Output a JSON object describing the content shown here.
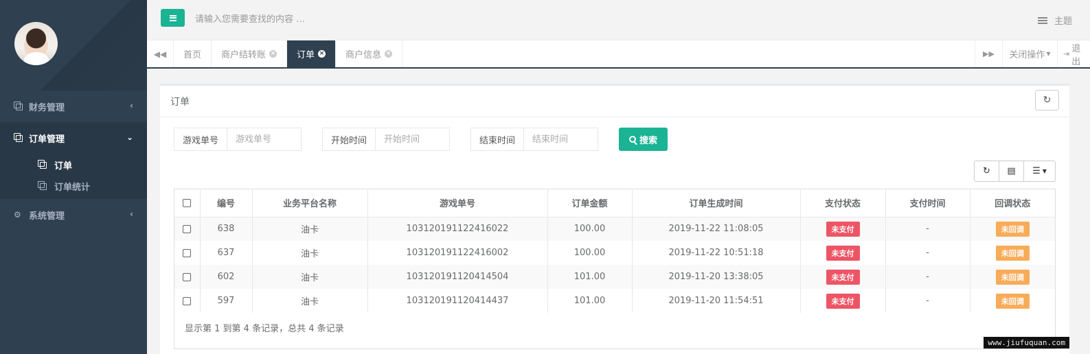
{
  "sidebar": {
    "menus": [
      {
        "label": "财务管理",
        "arrow": "‹"
      },
      {
        "label": "订单管理",
        "arrow": "⌄"
      },
      {
        "label": "系统管理",
        "arrow": "‹"
      }
    ],
    "submenu": [
      {
        "label": "订单"
      },
      {
        "label": "订单统计"
      }
    ]
  },
  "header": {
    "search_placeholder": "请输入您需要查找的内容 …",
    "theme_label": "主题"
  },
  "tabs": {
    "items": [
      {
        "label": "首页"
      },
      {
        "label": "商户结转账"
      },
      {
        "label": "订单"
      },
      {
        "label": "商户信息"
      }
    ],
    "close_ops_label": "关闭操作",
    "logout_label": "退出"
  },
  "panel": {
    "title": "订单",
    "filters": {
      "game_order_label": "游戏单号",
      "game_order_placeholder": "游戏单号",
      "start_time_label": "开始时间",
      "start_time_placeholder": "开始时间",
      "end_time_label": "结束时间",
      "end_time_placeholder": "结束时间",
      "search_label": "搜索"
    },
    "table": {
      "headers": [
        "编号",
        "业务平台名称",
        "游戏单号",
        "订单金额",
        "订单生成时间",
        "支付状态",
        "支付时间",
        "回调状态"
      ],
      "rows": [
        {
          "id": "638",
          "platform": "油卡",
          "game_order": "103120191122416022",
          "amount": "100.00",
          "created": "2019-11-22 11:08:05",
          "pay_status": "未支付",
          "pay_time": "-",
          "callback": "未回调"
        },
        {
          "id": "637",
          "platform": "油卡",
          "game_order": "103120191122416002",
          "amount": "100.00",
          "created": "2019-11-22 10:51:18",
          "pay_status": "未支付",
          "pay_time": "-",
          "callback": "未回调"
        },
        {
          "id": "602",
          "platform": "油卡",
          "game_order": "103120191120414504",
          "amount": "101.00",
          "created": "2019-11-20 13:38:05",
          "pay_status": "未支付",
          "pay_time": "-",
          "callback": "未回调"
        },
        {
          "id": "597",
          "platform": "油卡",
          "game_order": "103120191120414437",
          "amount": "101.00",
          "created": "2019-11-20 11:54:51",
          "pay_status": "未支付",
          "pay_time": "-",
          "callback": "未回调"
        }
      ]
    },
    "pagination_text": "显示第 1 到第 4 条记录，总共 4 条记录"
  },
  "watermark": "www.jiufuquan.com",
  "colors": {
    "sidebar_bg": "#2f4050",
    "accent": "#1ab394",
    "badge_red": "#ed5565",
    "badge_orange": "#f8ac59"
  }
}
